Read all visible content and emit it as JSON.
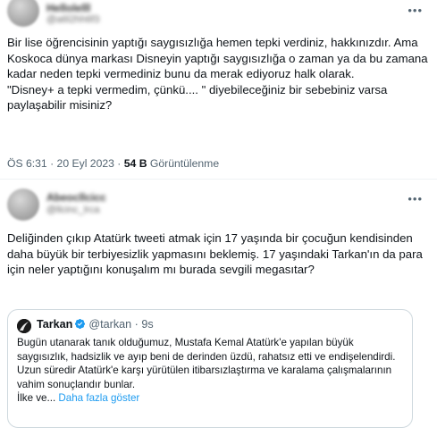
{
  "tweet1": {
    "body": [
      "Bir lise öğrencisinin yaptığı saygısızlığa hemen tepki verdiniz, hakkınızdır. Ama Koskoca dünya markası Disneyin yaptığı saygısızlığa o zaman ya da bu zamana kadar neden tepki vermediniz bunu da merak ediyoruz halk olarak.",
      "\"Disney+ a tepki vermedim, çünkü.... \" diyebileceğiniz bir sebebiniz varsa paylaşabilir misiniz?"
    ],
    "time": "ÖS 6:31 · 20 Eyl 2023 · ",
    "views_count": "54 B",
    "views_label": " Görüntülenme"
  },
  "tweet2": {
    "body": "Deliğinden çıkıp Atatürk tweeti atmak için 17 yaşında bir çocuğun kendisinden daha büyük bir terbiyesizlik yapmasını beklemiş. 17 yaşındaki Tarkan'ın da para için neler yaptığını konuşalım mı burada sevgili megasıtar?",
    "quote": {
      "name": "Tarkan",
      "handle": "@tarkan",
      "dot": " · ",
      "time": "9s",
      "text": [
        "Bugün utanarak tanık olduğumuz, Mustafa Kemal Atatürk'e yapılan büyük saygısızlık, hadsizlik ve ayıp beni de derinden üzdü, rahatsız etti ve endişelendirdi.",
        "Uzun süredir Atatürk'e karşı yürütülen itibarsızlaştırma ve karalama çalışmalarının vahim sonuçlandır bunlar.",
        "İlke ve..."
      ],
      "show_more": "Daha fazla göster"
    }
  },
  "colors": {
    "text": "#0f1419",
    "muted": "#536471",
    "link": "#1d9bf0",
    "verified": "#1d9bf0",
    "border": "#cfd9de"
  },
  "icons": {
    "more": "more-horizontal-icon",
    "verified": "verified-badge-icon"
  }
}
